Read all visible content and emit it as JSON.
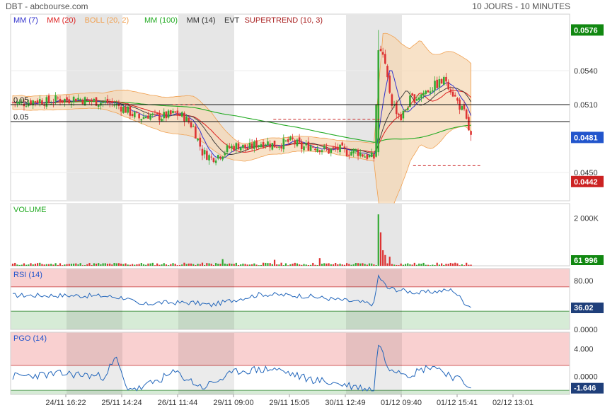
{
  "header": {
    "title": "DBT - abcbourse.com",
    "period": "10 JOURS - 10 MINUTES"
  },
  "legend": [
    {
      "label": "MM (7)",
      "color": "#3333cc"
    },
    {
      "label": "MM (20)",
      "color": "#dd2222"
    },
    {
      "label": "BOLL (20, 2)",
      "color": "#f0a050"
    },
    {
      "label": "MM (100)",
      "color": "#22aa22"
    },
    {
      "label": "MM (14)",
      "color": "#333333"
    },
    {
      "label": "EVT",
      "color": "#333333"
    },
    {
      "label": "SUPERTREND (10, 3)",
      "color": "#aa2222"
    }
  ],
  "colors": {
    "up": "#33aa33",
    "down": "#dd3333",
    "boll_fill": "#f5d5b0",
    "shade": "#e6e6e6",
    "rsi_high": "#f9d0d0",
    "rsi_low": "#d6ebd6",
    "price_last": "#2255cc",
    "price_high": "#118811",
    "price_low": "#cc2222",
    "oscillator": "#2266bb"
  },
  "chart_data": [
    {
      "type": "candlestick",
      "title": "",
      "ylim": [
        0.0425,
        0.059
      ],
      "y_ticks": [
        0.045,
        0.051,
        0.054
      ],
      "y_tick_labels": [
        "0.0450",
        "0.0510",
        "0.0540"
      ],
      "x_tick_labels": [
        "24/11 16:22",
        "25/11 14:24",
        "26/11 11:44",
        "29/11 09:00",
        "29/11 15:05",
        "30/11 12:49",
        "01/12 09:40",
        "01/12 15:41",
        "02/12 13:01"
      ],
      "sessions": 10,
      "shaded_sessions": [
        1,
        3,
        6
      ],
      "reference_lines": [
        {
          "value": 0.051,
          "label": "0.05"
        },
        {
          "value": 0.0495,
          "label": "0.05"
        }
      ],
      "dashed_levels": [
        0.051,
        0.0497,
        0.0456
      ],
      "price_badges": [
        {
          "value": 0.0576,
          "label": "0.0576",
          "kind": "high"
        },
        {
          "value": 0.0481,
          "label": "0.0481",
          "kind": "last"
        },
        {
          "value": 0.0442,
          "label": "0.0442",
          "kind": "low"
        }
      ],
      "close_profile": [
        [
          0,
          0.0512
        ],
        [
          4,
          0.0511
        ],
        [
          8,
          0.0513
        ],
        [
          12,
          0.0514
        ],
        [
          16,
          0.0512
        ],
        [
          20,
          0.0515
        ],
        [
          24,
          0.0514
        ],
        [
          28,
          0.0516
        ],
        [
          32,
          0.0514
        ],
        [
          36,
          0.0513
        ],
        [
          40,
          0.0512
        ],
        [
          44,
          0.0511
        ],
        [
          48,
          0.0508
        ],
        [
          52,
          0.0503
        ],
        [
          56,
          0.0498
        ],
        [
          60,
          0.0501
        ],
        [
          64,
          0.0499
        ],
        [
          68,
          0.05
        ],
        [
          72,
          0.0502
        ],
        [
          76,
          0.0499
        ],
        [
          80,
          0.049
        ],
        [
          84,
          0.0468
        ],
        [
          88,
          0.0463
        ],
        [
          92,
          0.0466
        ],
        [
          96,
          0.0472
        ],
        [
          100,
          0.0474
        ],
        [
          104,
          0.0471
        ],
        [
          108,
          0.0475
        ],
        [
          112,
          0.0477
        ],
        [
          116,
          0.0474
        ],
        [
          120,
          0.0476
        ],
        [
          124,
          0.0478
        ],
        [
          128,
          0.0472
        ],
        [
          132,
          0.0474
        ],
        [
          136,
          0.0472
        ],
        [
          140,
          0.0469
        ],
        [
          144,
          0.0471
        ],
        [
          148,
          0.0468
        ],
        [
          152,
          0.0469
        ],
        [
          156,
          0.0465
        ],
        [
          160,
          0.0463
        ],
        [
          162,
          0.0558
        ],
        [
          164,
          0.0552
        ],
        [
          168,
          0.0512
        ],
        [
          172,
          0.0498
        ],
        [
          176,
          0.0514
        ],
        [
          180,
          0.0518
        ],
        [
          184,
          0.0523
        ],
        [
          188,
          0.0528
        ],
        [
          192,
          0.0532
        ],
        [
          196,
          0.0516
        ],
        [
          200,
          0.0502
        ],
        [
          203,
          0.0481
        ]
      ],
      "boll_width_profile": [
        [
          0,
          0.0006
        ],
        [
          40,
          0.0007
        ],
        [
          50,
          0.0012
        ],
        [
          60,
          0.0014
        ],
        [
          80,
          0.0018
        ],
        [
          88,
          0.0016
        ],
        [
          100,
          0.0008
        ],
        [
          140,
          0.0006
        ],
        [
          160,
          0.0008
        ],
        [
          164,
          0.009
        ],
        [
          176,
          0.005
        ],
        [
          200,
          0.003
        ],
        [
          203,
          0.003
        ]
      ]
    },
    {
      "type": "bar",
      "title": "VOLUME",
      "ylim": [
        0,
        2600000
      ],
      "y_ticks": [
        2000000
      ],
      "y_tick_labels": [
        "2 000K"
      ],
      "last_label": "61 996",
      "spikes": [
        [
          162,
          2150000
        ],
        [
          163,
          1400000
        ],
        [
          164,
          650000
        ],
        [
          165,
          450000
        ],
        [
          167,
          380000
        ],
        [
          93,
          280000
        ],
        [
          136,
          320000
        ],
        [
          116,
          250000
        ]
      ]
    },
    {
      "type": "line",
      "title": "RSI (14)",
      "ylim": [
        0,
        100
      ],
      "y_ticks": [
        0,
        80
      ],
      "y_tick_labels": [
        "0.0000",
        "80.00"
      ],
      "zones": {
        "high": 70,
        "low": 30
      },
      "last_value": 36.02,
      "last_label": "36.02",
      "profile": [
        [
          0,
          56
        ],
        [
          20,
          56
        ],
        [
          40,
          55
        ],
        [
          50,
          52
        ],
        [
          56,
          40
        ],
        [
          64,
          44
        ],
        [
          80,
          44
        ],
        [
          88,
          40
        ],
        [
          96,
          47
        ],
        [
          110,
          58
        ],
        [
          130,
          55
        ],
        [
          160,
          42
        ],
        [
          162,
          88
        ],
        [
          166,
          68
        ],
        [
          180,
          60
        ],
        [
          195,
          65
        ],
        [
          200,
          45
        ],
        [
          203,
          36
        ]
      ]
    },
    {
      "type": "line",
      "title": "PGO (14)",
      "ylim": [
        -2.6,
        6.4
      ],
      "y_ticks": [
        0,
        4
      ],
      "y_tick_labels": [
        "0.0000",
        "4.000"
      ],
      "zones": {
        "high": 1.6,
        "low": -2.0
      },
      "last_value": -1.646,
      "last_label": "-1.646",
      "profile": [
        [
          0,
          0
        ],
        [
          24,
          0.4
        ],
        [
          40,
          0
        ],
        [
          46,
          2.6
        ],
        [
          50,
          -1.5
        ],
        [
          56,
          -1.8
        ],
        [
          72,
          0.6
        ],
        [
          84,
          -1.6
        ],
        [
          100,
          0.8
        ],
        [
          116,
          1.1
        ],
        [
          130,
          -0.3
        ],
        [
          160,
          -1.9
        ],
        [
          162,
          5.0
        ],
        [
          166,
          1.5
        ],
        [
          176,
          0.3
        ],
        [
          186,
          1.6
        ],
        [
          200,
          -0.9
        ],
        [
          203,
          -1.6
        ]
      ]
    }
  ]
}
